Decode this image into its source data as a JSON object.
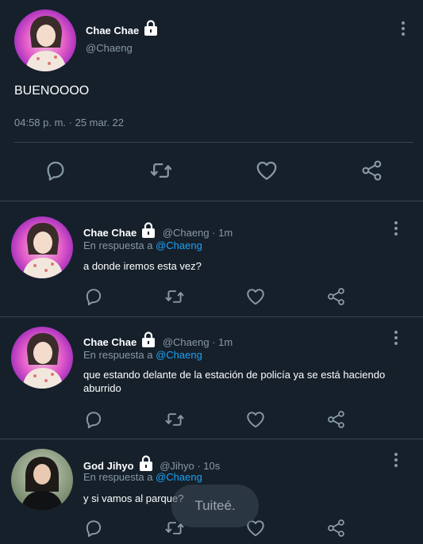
{
  "main": {
    "name": "Chae Chae",
    "handle": "@Chaeng",
    "text": "BUENOOOO",
    "timestamp": "04:58 p. m. · 25 mar. 22"
  },
  "replies": [
    {
      "name": "Chae Chae",
      "meta": "@Chaeng · 1m",
      "reply_prefix": "En respuesta a",
      "reply_to": "@Chaeng",
      "text": "a donde iremos esta vez?"
    },
    {
      "name": "Chae Chae",
      "meta": "@Chaeng · 1m",
      "reply_prefix": "En respuesta a",
      "reply_to": "@Chaeng",
      "text": "que estando delante de la estación de policía ya se está haciendo aburrido"
    },
    {
      "name": "God Jihyo",
      "meta": "@Jihyo · 10s",
      "reply_prefix": "En respuesta a",
      "reply_to": "@Chaeng",
      "text": "y si vamos al parque?"
    }
  ],
  "toast": "Tuiteé.",
  "icons": {
    "reply": "reply-icon",
    "retweet": "retweet-icon",
    "like": "heart-icon",
    "share": "share-icon",
    "lock": "lock-icon",
    "more": "more-vertical-icon"
  },
  "colors": {
    "background": "#15202b",
    "secondary_text": "#8899a6",
    "link": "#1da1f2",
    "divider": "#38444d"
  }
}
